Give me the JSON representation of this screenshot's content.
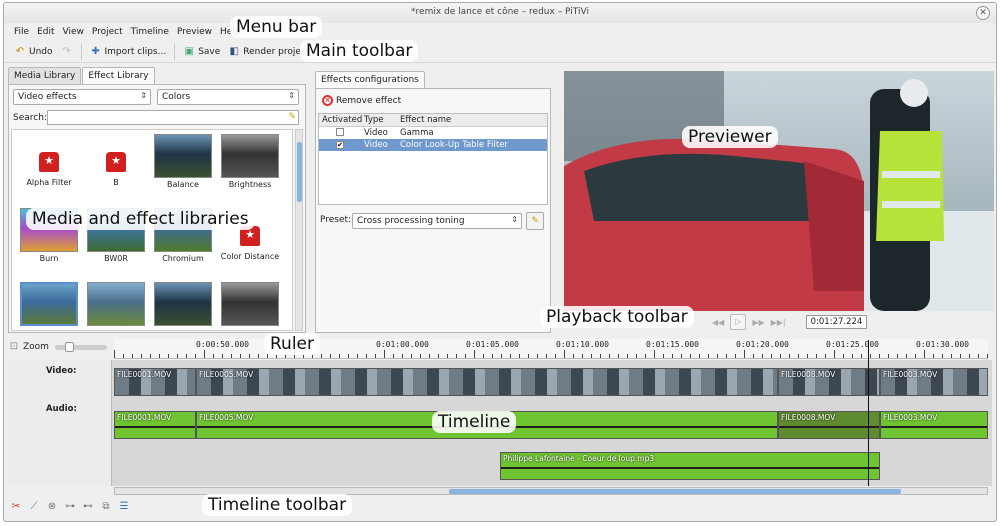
{
  "window": {
    "title": "*remix de lance et cône – redux – PiTiVi"
  },
  "menu": [
    "File",
    "Edit",
    "View",
    "Project",
    "Timeline",
    "Preview",
    "Help"
  ],
  "toolbar": {
    "undo": "Undo",
    "import": "Import clips...",
    "save": "Save",
    "render": "Render project"
  },
  "callouts": {
    "menubar": "Menu bar",
    "toolbar": "Main toolbar",
    "previewer": "Previewer",
    "libraries": "Media and effect libraries",
    "playback": "Playback toolbar",
    "ruler": "Ruler",
    "timeline": "Timeline",
    "tltoolbar": "Timeline toolbar"
  },
  "library": {
    "tabs": [
      "Media Library",
      "Effect Library"
    ],
    "category": "Video effects",
    "subcategory": "Colors",
    "search_label": "Search:",
    "effects": [
      {
        "name": "Alpha Filter",
        "kind": "icon"
      },
      {
        "name": "B",
        "kind": "icon"
      },
      {
        "name": "Balance",
        "kind": "thumb"
      },
      {
        "name": "Brightness",
        "kind": "thumb"
      },
      {
        "name": "Burn",
        "kind": "thumb"
      },
      {
        "name": "BW0R",
        "kind": "thumb"
      },
      {
        "name": "Chromium",
        "kind": "thumb"
      },
      {
        "name": "Color Distance",
        "kind": "icon"
      },
      {
        "name": "",
        "kind": "thumb"
      },
      {
        "name": "",
        "kind": "thumb"
      },
      {
        "name": "",
        "kind": "thumb"
      },
      {
        "name": "",
        "kind": "thumb"
      }
    ]
  },
  "effects_config": {
    "tab": "Effects configurations",
    "remove": "Remove effect",
    "headers": [
      "Activated",
      "Type",
      "Effect name"
    ],
    "rows": [
      {
        "activated": false,
        "type": "Video",
        "name": "Gamma"
      },
      {
        "activated": true,
        "type": "Video",
        "name": "Color Look-Up Table Filter"
      }
    ],
    "preset_label": "Preset:",
    "preset_value": "Cross processing toning"
  },
  "playback": {
    "timecode": "0:01:27.224"
  },
  "zoom_label": "Zoom",
  "ruler": [
    "0:00:50.000",
    "0:01:00.000",
    "0:01:05.000",
    "0:01:10.000",
    "0:01:15.000",
    "0:01:20.000",
    "0:01:25.000",
    "0:01:30.000"
  ],
  "tracks": {
    "video": "Video:",
    "audio": "Audio:"
  },
  "clips": {
    "video": [
      "FILE0001.MOV",
      "FILE0005.MOV",
      "FILE0008.MOV",
      "FILE0003.MOV"
    ],
    "audio": [
      "FILE0001.MOV",
      "FILE0005.MOV",
      "FILE0008.MOV",
      "FILE0003.MOV"
    ],
    "music": "Philippe Lafontaine - Coeur de loup.mp3"
  }
}
